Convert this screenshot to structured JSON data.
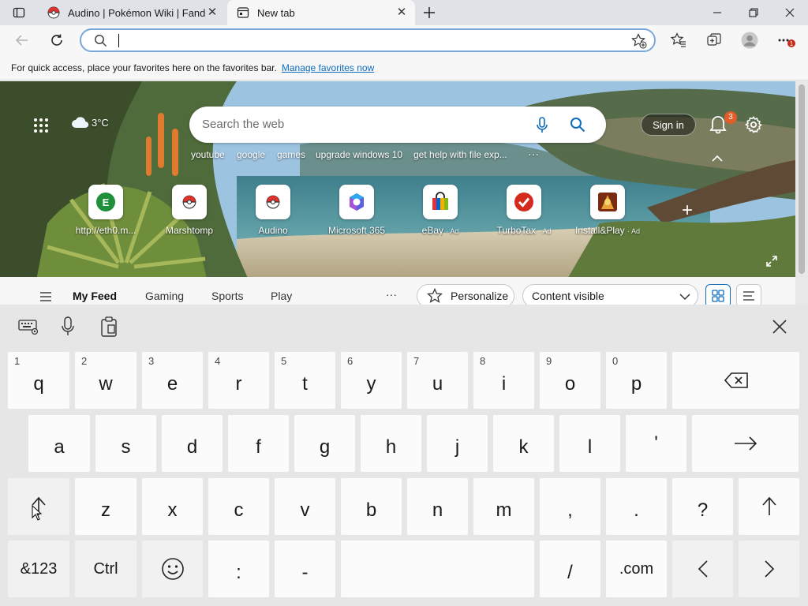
{
  "tabs": [
    {
      "title": "Audino | Pokémon Wiki | Fandom",
      "icon": "pokeball-icon"
    },
    {
      "title": "New tab",
      "icon": "new-tab-icon"
    }
  ],
  "address_bar": {
    "value": "",
    "placeholder": ""
  },
  "favorites_bar": {
    "message": "For quick access, place your favorites here on the favorites bar.",
    "link": "Manage favorites now"
  },
  "ntp": {
    "weather": "3°C",
    "search_placeholder": "Search the web",
    "quick_links": [
      "youtube",
      "google",
      "games",
      "upgrade windows 10",
      "get help with file exp..."
    ],
    "more": "···",
    "sign_in": "Sign in",
    "notification_count": "3",
    "tiles": [
      {
        "label": "http://eth0.m...",
        "ad": "",
        "icon": "letter-e-icon"
      },
      {
        "label": "Marshtomp",
        "ad": "",
        "icon": "pokeball-icon"
      },
      {
        "label": "Audino",
        "ad": "",
        "icon": "pokeball-icon"
      },
      {
        "label": "Microsoft 365",
        "ad": "",
        "icon": "microsoft-365-icon"
      },
      {
        "label": "eBay",
        "ad": "· Ad",
        "icon": "ebay-bag-icon"
      },
      {
        "label": "TurboTax",
        "ad": "· Ad",
        "icon": "turbotax-check-icon"
      },
      {
        "label": "Install&Play",
        "ad": "· Ad",
        "icon": "game-icon"
      }
    ],
    "add_tile": "+",
    "feed": {
      "tabs": [
        "My Feed",
        "Gaming",
        "Sports",
        "Play"
      ],
      "more": "···",
      "personalize": "Personalize",
      "content_visibility": "Content visible"
    }
  },
  "keyboard": {
    "row1": [
      {
        "num": "1",
        "ch": "q"
      },
      {
        "num": "2",
        "ch": "w"
      },
      {
        "num": "3",
        "ch": "e"
      },
      {
        "num": "4",
        "ch": "r"
      },
      {
        "num": "5",
        "ch": "t"
      },
      {
        "num": "6",
        "ch": "y"
      },
      {
        "num": "7",
        "ch": "u"
      },
      {
        "num": "8",
        "ch": "i"
      },
      {
        "num": "9",
        "ch": "o"
      },
      {
        "num": "0",
        "ch": "p"
      }
    ],
    "row2": [
      "a",
      "s",
      "d",
      "f",
      "g",
      "h",
      "j",
      "k",
      "l",
      "'"
    ],
    "row3": [
      "z",
      "x",
      "c",
      "v",
      "b",
      "n",
      "m",
      ",",
      ".",
      "?"
    ],
    "symbols_key": "&123",
    "ctrl_key": "Ctrl",
    "colon_key": ":",
    "dash_key": "-",
    "slash_key": "/",
    "dotcom_key": ".com"
  }
}
